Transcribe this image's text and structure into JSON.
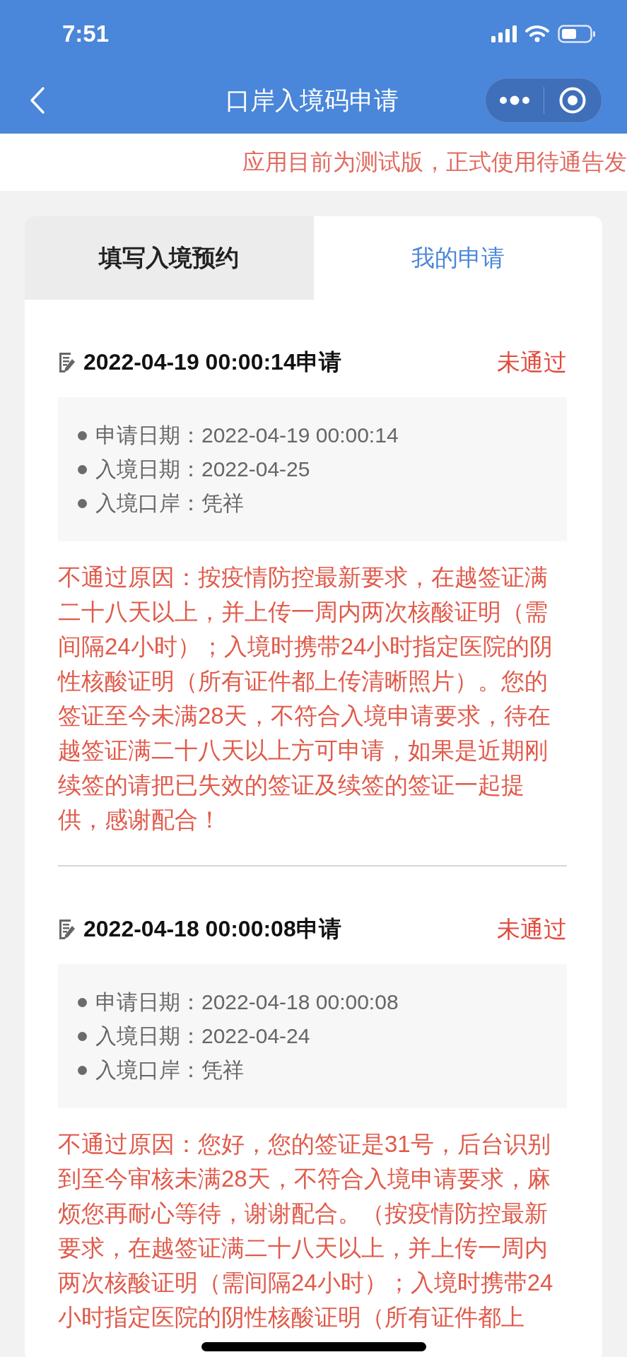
{
  "status_bar": {
    "time": "7:51"
  },
  "nav_bar": {
    "title": "口岸入境码申请"
  },
  "notice": "应用目前为测试版，正式使用待通告发",
  "tabs": [
    {
      "label": "填写入境预约",
      "selected": false
    },
    {
      "label": "我的申请",
      "selected": true
    }
  ],
  "applications": [
    {
      "title": "2022-04-19 00:00:14申请",
      "status": "未通过",
      "details": [
        "申请日期：2022-04-19 00:00:14",
        "入境日期：2022-04-25",
        "入境口岸：凭祥"
      ],
      "reason": "不通过原因：按疫情防控最新要求，在越签证满二十八天以上，并上传一周内两次核酸证明（需间隔24小时）；入境时携带24小时指定医院的阴性核酸证明（所有证件都上传清晰照片）。您的签证至今未满28天，不符合入境申请要求，待在越签证满二十八天以上方可申请，如果是近期刚续签的请把已失效的签证及续签的签证一起提供，感谢配合！"
    },
    {
      "title": "2022-04-18 00:00:08申请",
      "status": "未通过",
      "details": [
        "申请日期：2022-04-18 00:00:08",
        "入境日期：2022-04-24",
        "入境口岸：凭祥"
      ],
      "reason": "不通过原因：您好，您的签证是31号，后台识别到至今审核未满28天，不符合入境申请要求，麻烦您再耐心等待，谢谢配合。（按疫情防控最新要求，在越签证满二十八天以上，并上传一周内两次核酸证明（需间隔24小时）；入境时携带24小时指定医院的阴性核酸证明（所有证件都上"
    }
  ]
}
